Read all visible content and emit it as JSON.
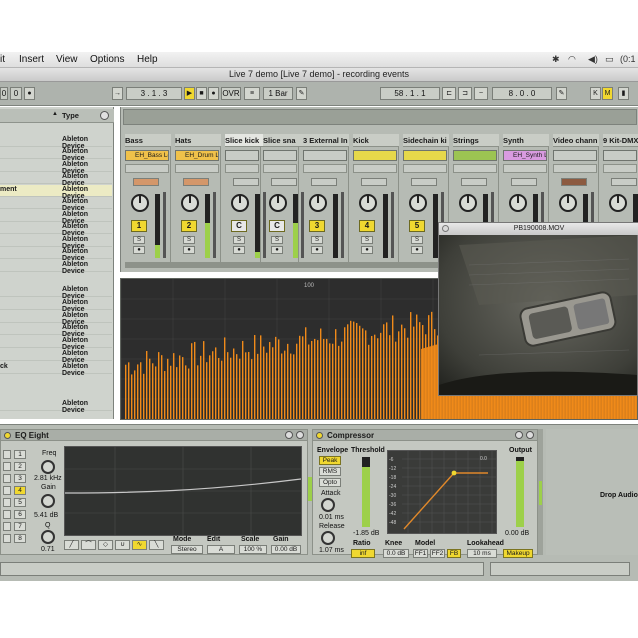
{
  "menubar": {
    "items": [
      "it",
      "Insert",
      "View",
      "Options",
      "Help"
    ],
    "clock": "(0:1"
  },
  "window": {
    "title": "Live 7 demo  [Live 7 demo] - recording events"
  },
  "transport": {
    "left_values": [
      "0",
      "0"
    ],
    "position": "3 .  1 .  3",
    "ovr": "OVR",
    "quantize": "1 Bar",
    "arrangement_pos": "58 .  1 .  1",
    "loop_length": "8 .  0 .  0"
  },
  "browser": {
    "column_type": "Type",
    "rows": [
      {
        "name": "",
        "type": "Ableton Device"
      },
      {
        "name": "",
        "type": "Ableton Device"
      },
      {
        "name": "",
        "type": "Ableton Device"
      },
      {
        "name": "",
        "type": "Ableton Device"
      },
      {
        "name": "ment",
        "type": "Ableton Device"
      },
      {
        "name": "",
        "type": "Ableton Device"
      },
      {
        "name": "",
        "type": "Ableton Device"
      },
      {
        "name": "",
        "type": "Ableton Device"
      },
      {
        "name": "",
        "type": "Ableton Device"
      },
      {
        "name": "",
        "type": "Ableton Device"
      },
      {
        "name": "",
        "type": "Ableton Device"
      },
      {
        "name": "",
        "type": "Ableton Device"
      },
      {
        "name": "",
        "type": "Ableton Device"
      },
      {
        "name": "",
        "type": "Ableton Device"
      },
      {
        "name": "",
        "type": "Ableton Device"
      },
      {
        "name": "",
        "type": "Ableton Device"
      },
      {
        "name": "",
        "type": "Ableton Device"
      },
      {
        "name": "ck",
        "type": "Ableton Device"
      },
      {
        "name": "",
        "type": "Ableton Device"
      }
    ]
  },
  "tracks": [
    {
      "name": "Bass",
      "clip": "EH_Bass Lo",
      "number": "1",
      "clip_color": "#f0c14a",
      "meter": 0.2
    },
    {
      "name": "Hats",
      "clip": "EH_Drum Lo",
      "number": "2",
      "clip_color": "#f0c14a",
      "meter": 0.55
    },
    {
      "name": "Slice kick",
      "clip": "",
      "number": "C",
      "clip_color": "#c8ccc6",
      "meter": 0.1
    },
    {
      "name": "Slice sna",
      "clip": "",
      "number": "C",
      "clip_color": "#c8ccc6",
      "meter": 0.55
    },
    {
      "name": "3 External In",
      "clip": "",
      "number": "3",
      "clip_color": "#c8ccc6",
      "meter": 0.0
    },
    {
      "name": "Kick",
      "clip": "",
      "number": "4",
      "clip_color": "#e6d84a",
      "meter": 0.0
    },
    {
      "name": "Sidechain ki",
      "clip": "",
      "number": "5",
      "clip_color": "#e6d84a",
      "meter": 0.0
    },
    {
      "name": "Strings",
      "clip": "",
      "number": "",
      "clip_color": "#9cc452",
      "meter": 0.0
    },
    {
      "name": "Synth",
      "clip": "EH_Synth Lo",
      "number": "",
      "clip_color": "#d99be0",
      "meter": 0.0
    },
    {
      "name": "Video chann",
      "clip": "",
      "number": "",
      "clip_color": "#c8ccc6",
      "meter": 0.0
    },
    {
      "name": "9 Kit-DMX",
      "clip": "",
      "number": "",
      "clip_color": "#c8ccc6",
      "meter": 0.0
    }
  ],
  "spectrum": {
    "scale_label": "100",
    "color": "#f08a1a"
  },
  "video_window": {
    "title": "PB190008.MOV"
  },
  "eq_eight": {
    "title": "EQ Eight",
    "band_numbers": [
      "1",
      "2",
      "3",
      "4",
      "5",
      "6",
      "7",
      "8"
    ],
    "freq_label": "Freq",
    "freq_value": "2.81 kHz",
    "gain_label": "Gain",
    "gain_value": "5.41 dB",
    "q_label": "Q",
    "q_value": "0.71",
    "mode_label": "Mode",
    "mode_value": "Stereo",
    "edit_label": "Edit",
    "edit_value": "A",
    "scale_label": "Scale",
    "scale_value": "100 %",
    "gain2_label": "Gain",
    "gain2_value": "0.00 dB"
  },
  "compressor": {
    "title": "Compressor",
    "envelope_label": "Envelope",
    "env_options": [
      "Peak",
      "RMS",
      "Opto"
    ],
    "threshold_label": "Threshold",
    "threshold_value": "-1.85 dB",
    "attack_label": "Attack",
    "attack_value": "0.01 ms",
    "release_label": "Release",
    "release_value": "1.07 ms",
    "ratio_label": "Ratio",
    "ratio_value": "inf",
    "knee_label": "Knee",
    "knee_value": "0.0 dB",
    "model_label": "Model",
    "model_options": [
      "FF1",
      "FF2",
      "FB"
    ],
    "lookahead_label": "Lookahead",
    "lookahead_value": "10 ms",
    "output_label": "Output",
    "output_value": "0.00 dB",
    "makeup_label": "Makeup",
    "graph_ticks": [
      "-6",
      "-12",
      "-18",
      "-24",
      "-30",
      "-36",
      "-42",
      "-48"
    ],
    "graph_top_value": "0.0"
  },
  "drop_area": {
    "label": "Drop Audio"
  }
}
